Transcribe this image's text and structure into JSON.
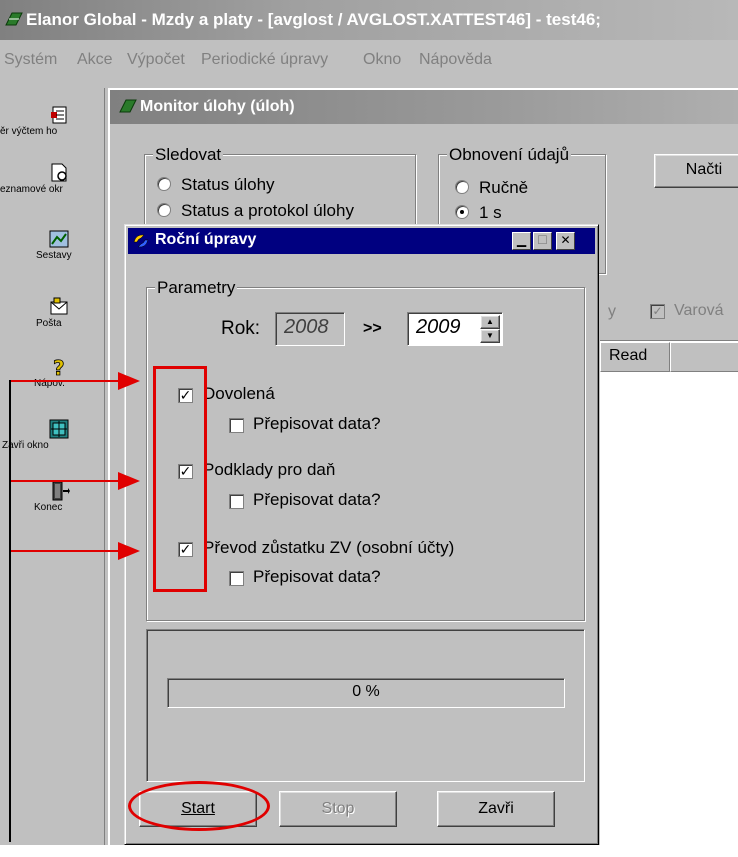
{
  "app": {
    "title": "Elanor Global - Mzdy a platy - [avglost / AVGLOST.XATTEST46] - test46;",
    "menu": [
      "Systém",
      "Akce",
      "Výpočet",
      "Periodické úpravy",
      "Okno",
      "Nápověda"
    ]
  },
  "toolbar": {
    "items": [
      {
        "label": "ěr výčtem ho",
        "icon": "list-icon"
      },
      {
        "label": "eznamové okr",
        "icon": "document-icon"
      },
      {
        "label": "Sestavy",
        "icon": "report-icon"
      },
      {
        "label": "Pošta",
        "icon": "mail-icon"
      },
      {
        "label": "Nápov.",
        "icon": "help-icon"
      },
      {
        "label": "Zavři okno",
        "icon": "close-window-icon"
      },
      {
        "label": "Konec",
        "icon": "exit-icon"
      }
    ]
  },
  "monitor": {
    "title": "Monitor úlohy (úloh)",
    "sledovat": {
      "legend": "Sledovat",
      "options": [
        "Status úlohy",
        "Status a protokol úlohy"
      ]
    },
    "obnoveni": {
      "legend": "Obnovení údajů",
      "options": [
        "Ručně",
        "1 s"
      ]
    },
    "load_button": "Načti",
    "partial_label": "y",
    "warning_label": "Varová",
    "column_read": "Read"
  },
  "dialog": {
    "title": "Roční úpravy",
    "params_legend": "Parametry",
    "year_label": "Rok:",
    "year_from": "2008",
    "arrow": ">>",
    "year_to": "2009",
    "items": [
      {
        "label": "Dovolená",
        "checked": true,
        "overwrite_label": "Přepisovat data?",
        "overwrite_checked": false
      },
      {
        "label": "Podklady pro daň",
        "checked": true,
        "overwrite_label": "Přepisovat data?",
        "overwrite_checked": false
      },
      {
        "label": "Převod zůstatku ZV (osobní účty)",
        "checked": true,
        "overwrite_label": "Přepisovat data?",
        "overwrite_checked": false
      }
    ],
    "progress_text": "0 %",
    "progress_percent": 0,
    "buttons": {
      "start": "Start",
      "stop": "Stop",
      "close": "Zavři"
    }
  },
  "colors": {
    "annotation": "#e00000",
    "dialog_title_bg": "#000080",
    "window_bg": "#c0c0c0"
  }
}
